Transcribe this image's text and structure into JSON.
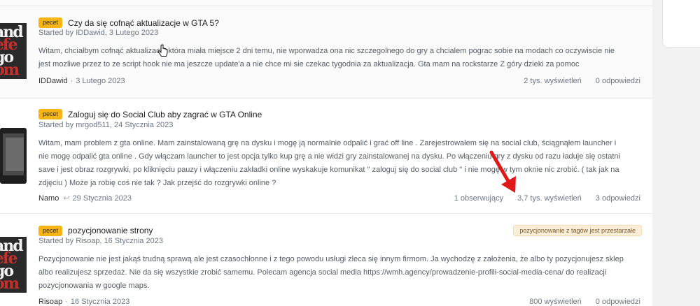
{
  "topics": [
    {
      "badge": "pecet",
      "title": "Czy da się cofnąć aktualizacje w GTA 5?",
      "started": "Started by IDDawid, 3 Lutego 2023",
      "excerpt_lines": [
        "Witam, chciałbym cofnąć aktualizacje która miała miejsce 2 dni temu, nie wporwadza ona nic szczegolnego do gry a chcialem pograc sobie na modach co oczywiscie nie",
        "jest mozliwe przez to ze script hook nie ma jeszcze update'a a nie chce mi sie czekac tygodnia za aktualizacja. Gta mam na rockstarze Z góry dzieki za pomoc"
      ],
      "author": "IDDawid",
      "date": "3 Lutego 2023",
      "views": "2 tys. wyświetleń",
      "replies": "0 odpowiedzi"
    },
    {
      "badge": "pecet",
      "title": "Zaloguj się do Social Club aby zagrać w GTA Online",
      "started": "Started by mrgod511, 24 Stycznia 2023",
      "excerpt_lines": [
        "Witam, mam problem z gta online. Mam zainstalowaną grę na dysku i mogę ją normalnie odpalić i grać off line . Zarejestrowałem się na social club, ściągnąłem launcher i",
        "nie mogę odpalić gta online . Gdy włączam launcher to jest opcja tylko kup grę a nie widzi gry zainstalowanej na dysku. Po włączeniu gry z dysku od razu ładuje się ostatni",
        "save i jest obraz rozgrywki, po kliknięciu pauzy i włączeniu zakładki online wyskakuje komunikat \" zaloguj się do social club \" i nie mogę w tym oknie nic zrobić. ( tak jak na",
        "zdjęciu ) Może ja robię coś nie tak ? Jak przejść do rozgrywki online ?"
      ],
      "author": "Namo",
      "date": "29 Stycznia 2023",
      "followers": "1 obserwujący",
      "views": "3,7 tys. wyświetleń",
      "replies": "3 odpowiedzi"
    },
    {
      "badge": "pecet",
      "title": "pozycjonowanie strony",
      "tag": "pozycjonowanie z tagów jest przestarzałe",
      "started": "Started by Risoap, 16 Stycznia 2023",
      "excerpt_lines": [
        "Pozycjonowanie nie jest jakąś trudną sprawą ale jest czasochłonne i z tego powodu usługi zleca się innym firmom. Ja wychodzę z założenia, że albo ty pozycjonujesz sklep",
        "albo realizujesz sprzedaż. Nie da się wszystkie zrobić samemu. Polecam agencja social media https://wmh.agency/prowadzenie-profili-social-media-cena/ do realizacji",
        "pozycjonowania w google maps."
      ],
      "author": "Risoap",
      "date": "16 Stycznia 2023",
      "views": "800 wyświetleń",
      "replies": "0 odpowiedzi"
    }
  ],
  "avatar_text": [
    "and",
    "efe",
    "go",
    "om"
  ]
}
